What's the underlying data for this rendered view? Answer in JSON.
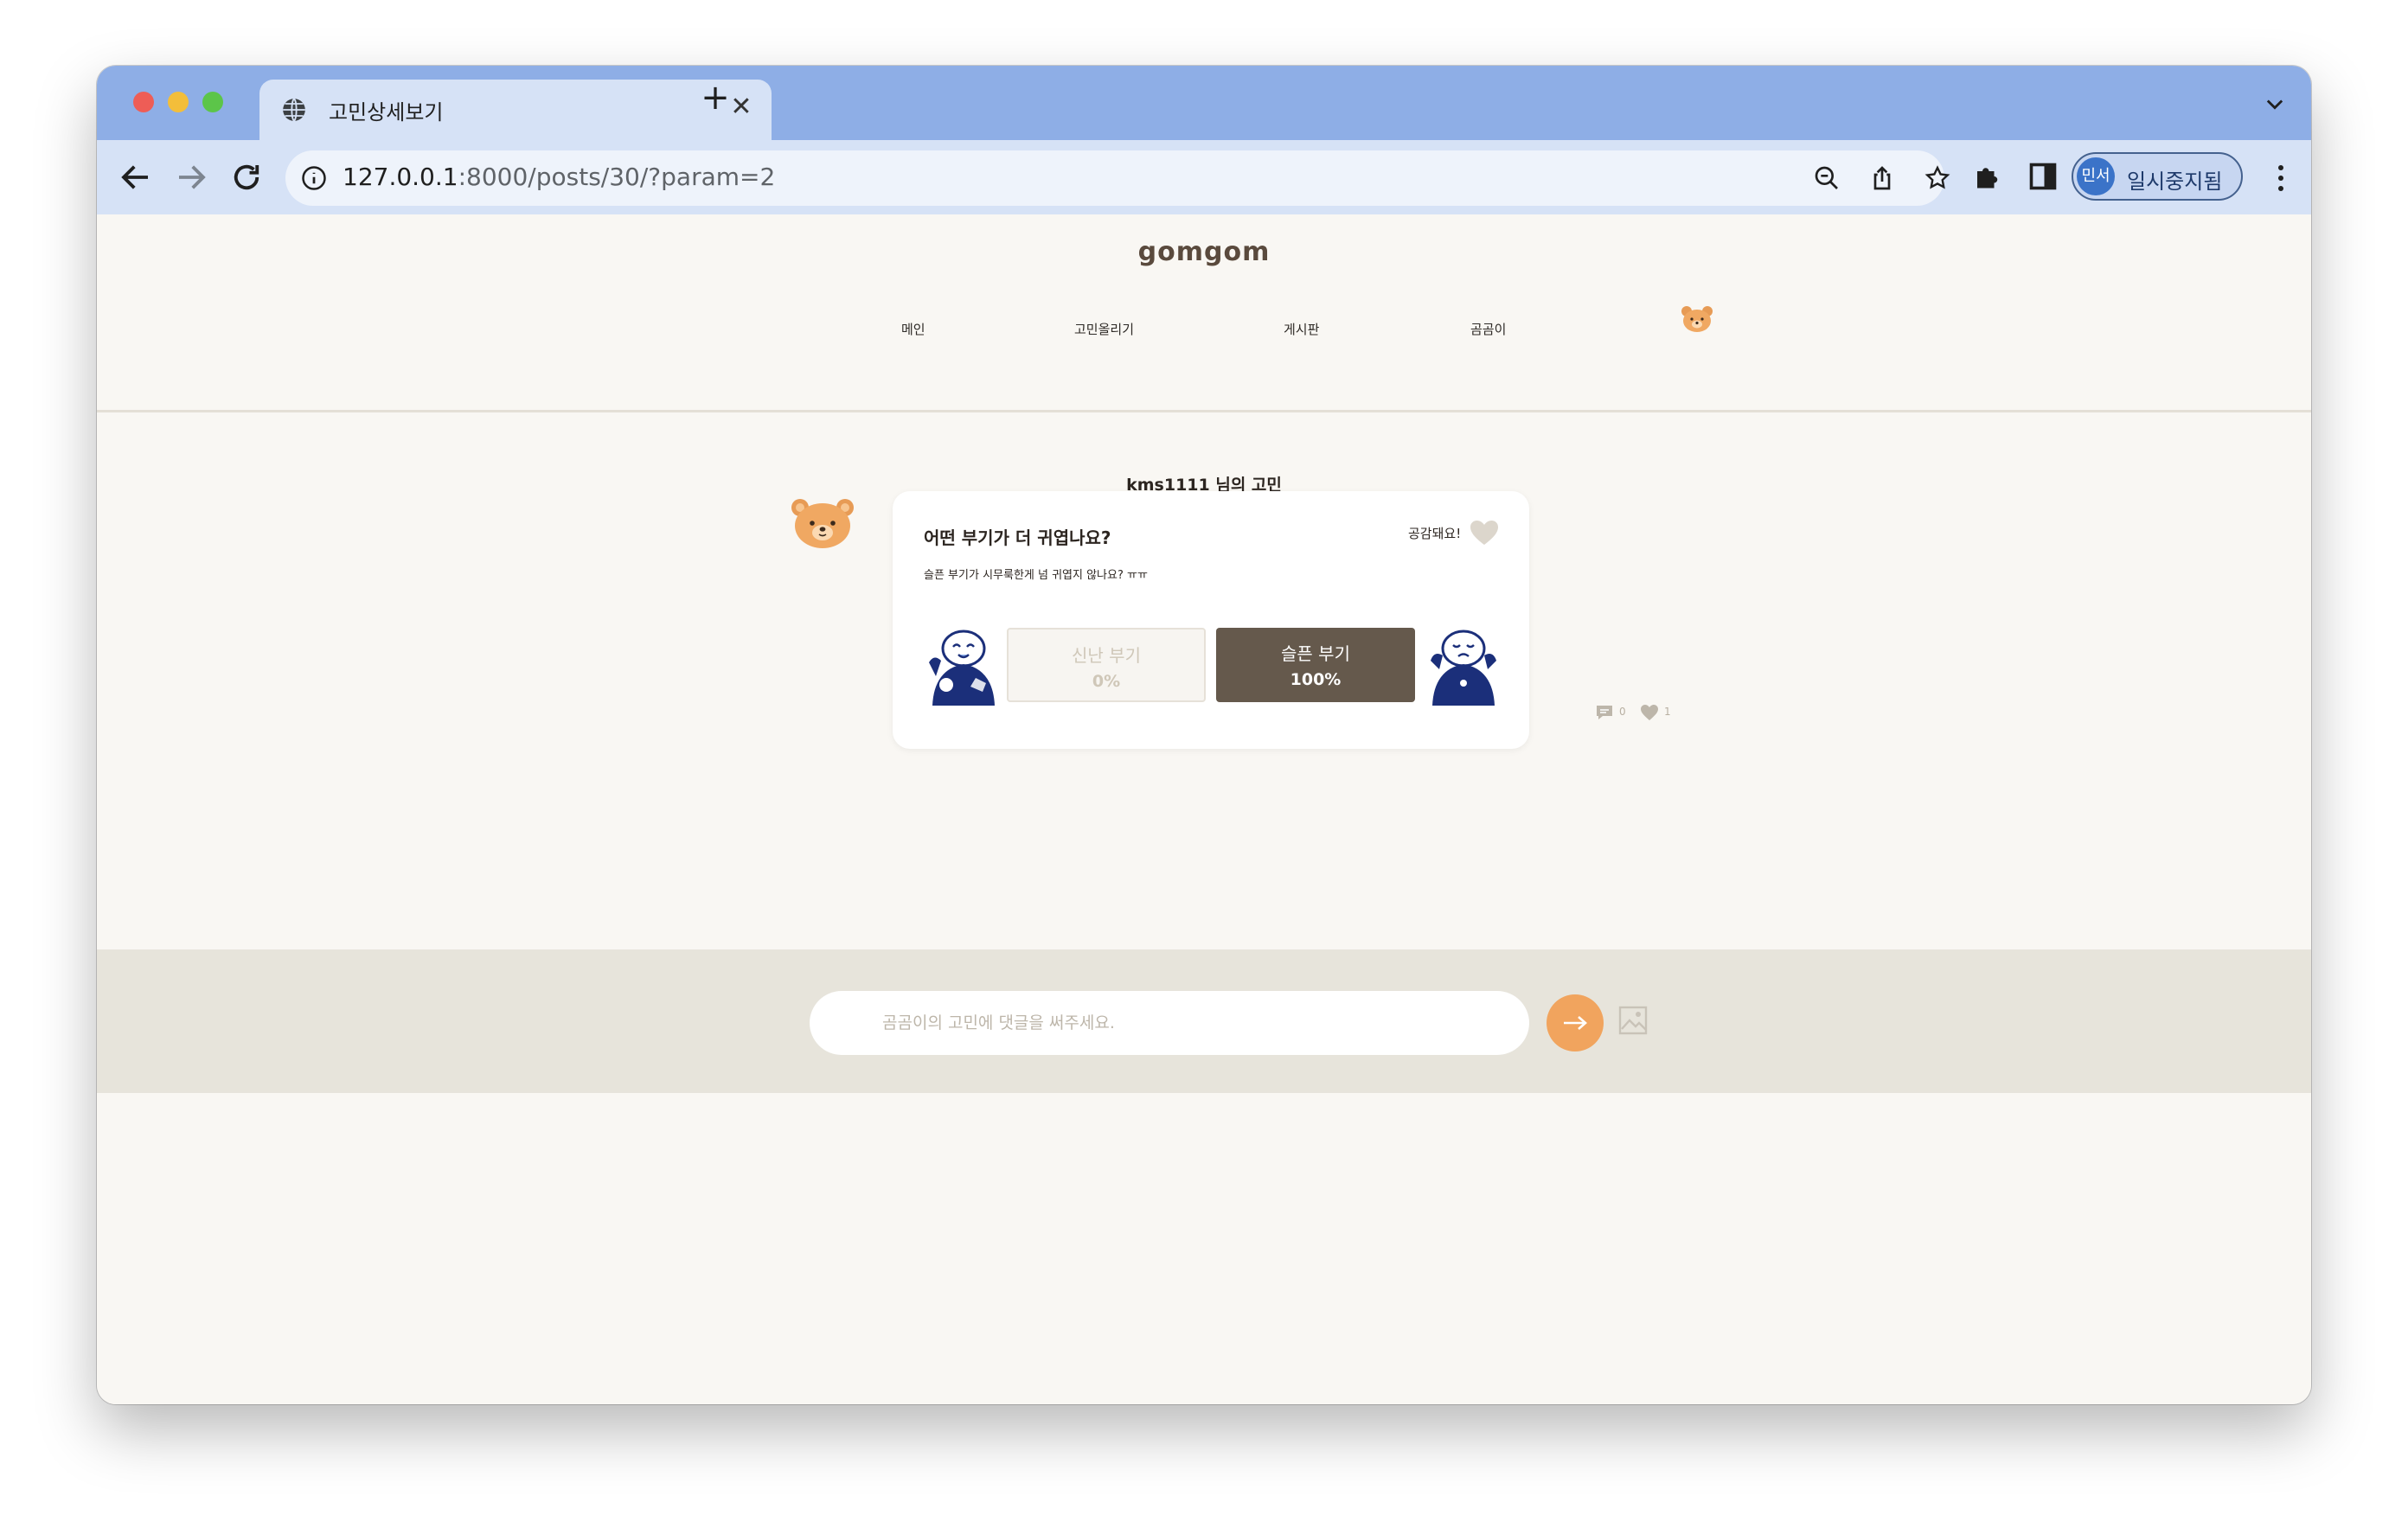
{
  "browser": {
    "tab_title": "고민상세보기",
    "tab_close": "✕",
    "new_tab": "+",
    "url_host": "127.0.0.1",
    "url_path": ":8000/posts/30/?param=2",
    "profile_avatar": "민서",
    "profile_label": "일시중지됨"
  },
  "site": {
    "logo": "gomgom",
    "nav": [
      "메인",
      "고민올리기",
      "게시판",
      "곰곰이"
    ]
  },
  "post": {
    "owner_heading": "kms1111 님의 고민",
    "title": "어떤 부기가 더 귀엽나요?",
    "body": "슬픈 부기가 시무룩한게 넘 귀엽지 않나요? ㅠㅠ",
    "empathy_label": "공감돼요!",
    "options": [
      {
        "label": "신난 부기",
        "percent": "0%"
      },
      {
        "label": "슬픈 부기",
        "percent": "100%"
      }
    ],
    "comment_count": "0",
    "like_count": "1"
  },
  "comment": {
    "placeholder": "곰곰이의 고민에 댓글을 써주세요."
  },
  "colors": {
    "tab_strip": "#8eaee6",
    "toolbar": "#d6e2f6",
    "page_bg": "#f9f7f3",
    "selected_option": "#65594c",
    "send_button": "#f1a45e",
    "comment_bar": "#e7e4db"
  }
}
